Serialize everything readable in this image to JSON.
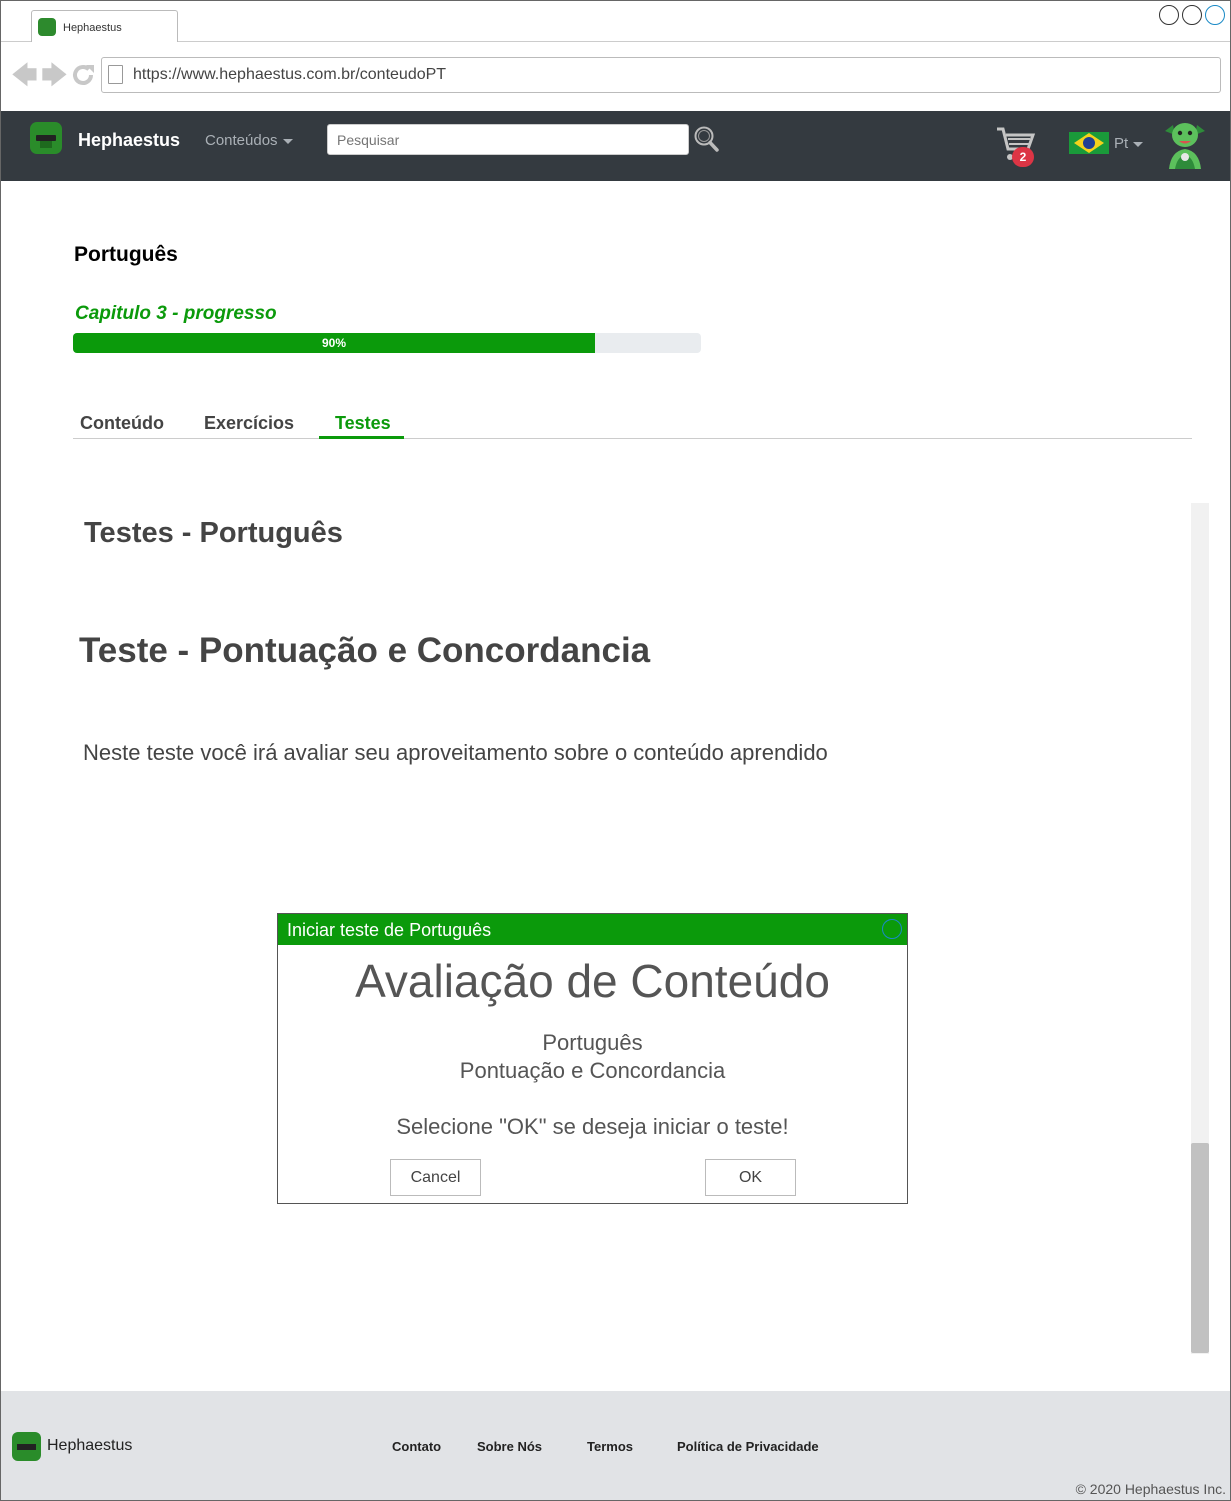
{
  "browser": {
    "tab_title": "Hephaestus",
    "url": "https://www.hephaestus.com.br/conteudoPT"
  },
  "navbar": {
    "brand": "Hephaestus",
    "menu_label": "Conteúdos",
    "search_placeholder": "Pesquisar",
    "cart_count": "2",
    "language": "Pt"
  },
  "page": {
    "title": "Português",
    "progress_label": "Capitulo 3 - progresso",
    "progress_value": 0.9,
    "progress_text": "90%",
    "tabs": [
      {
        "label": "Conteúdo",
        "active": false
      },
      {
        "label": "Exercícios",
        "active": false
      },
      {
        "label": "Testes",
        "active": true
      }
    ],
    "section_title": "Testes - Português",
    "test_title": "Teste - Pontuação e Concordancia",
    "test_description": "Neste teste você irá avaliar seu aproveitamento sobre o conteúdo aprendido"
  },
  "modal": {
    "title": "Iniciar teste de Português",
    "heading": "Avaliação de Conteúdo",
    "subject": "Português",
    "topic": "Pontuação e Concordancia",
    "prompt": "Selecione \"OK\" se deseja iniciar o teste!",
    "cancel_label": "Cancel",
    "ok_label": "OK"
  },
  "footer": {
    "brand": "Hephaestus",
    "links": [
      "Contato",
      "Sobre Nós",
      "Termos",
      "Política de Privacidade"
    ],
    "copyright": "© 2020 Hephaestus Inc."
  },
  "colors": {
    "accent": "#0b9a0b",
    "navbar": "#343a40",
    "badge": "#dc3545"
  }
}
